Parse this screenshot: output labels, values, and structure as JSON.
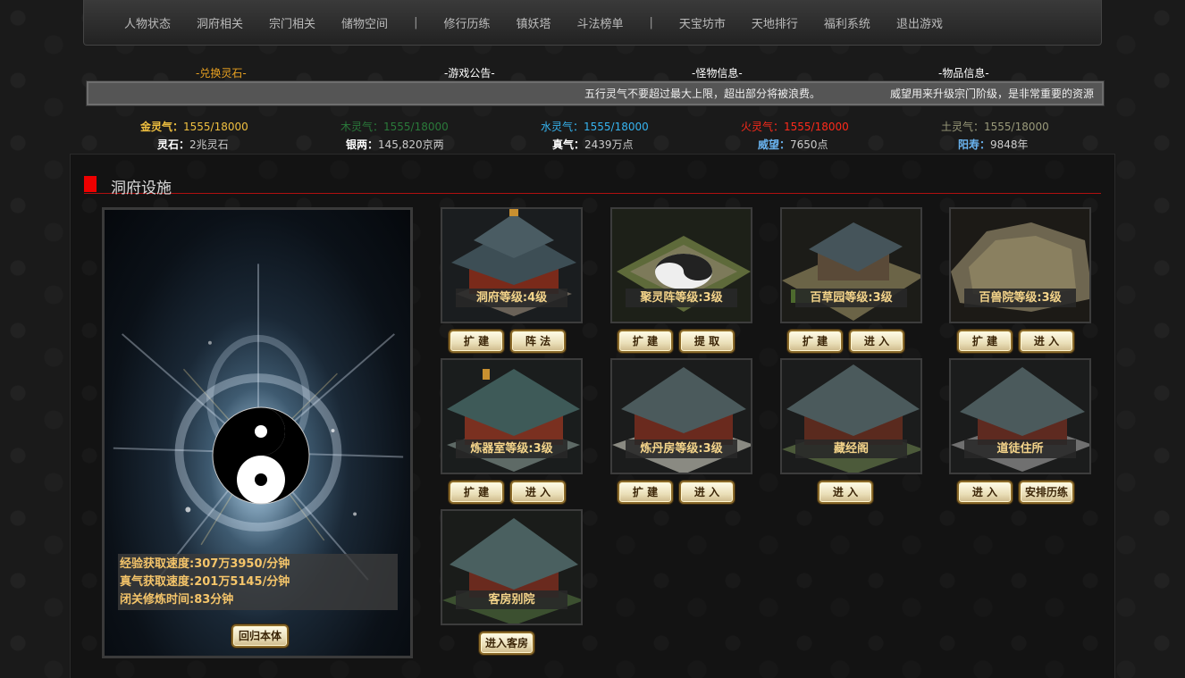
{
  "nav": {
    "items": [
      "人物状态",
      "洞府相关",
      "宗门相关",
      "储物空间",
      "|",
      "修行历练",
      "镇妖塔",
      "斗法榜单",
      "|",
      "天宝坊市",
      "天地排行",
      "福利系统",
      "退出游戏"
    ]
  },
  "notices": {
    "exchange": "-兑换灵石-",
    "announcement": "-游戏公告-",
    "monster": "-怪物信息-",
    "item": "-物品信息-",
    "marquee_1": "五行灵气不要超过最大上限，超出部分将被浪费。",
    "marquee_2": "威望用来升级宗门阶级，是非常重要的资源"
  },
  "resources": {
    "metal_label": "金灵气：",
    "metal_value": "1555/18000",
    "wood_label": "木灵气：",
    "wood_value": "1555/18000",
    "water_label": "水灵气：",
    "water_value": "1555/18000",
    "fire_label": "火灵气：",
    "fire_value": "1555/18000",
    "earth_label": "土灵气：",
    "earth_value": "1555/18000",
    "stone_label": "灵石：",
    "stone_value": "2兆灵石",
    "silver_label": "银两：",
    "silver_value": "145,820京两",
    "qi_label": "真气：",
    "qi_value": "2439万点",
    "prestige_label": "威望：",
    "prestige_value": "7650点",
    "life_label": "阳寿：",
    "life_value": "9848年"
  },
  "colors": {
    "metal": "#f0c040",
    "wood": "#2a7a3a",
    "water": "#36b4f0",
    "fire": "#ff2a1a",
    "earth": "#9a9a7a",
    "exchange": "#e8a020",
    "section_bar": "#ee0000",
    "stat_text": "#f5c56a"
  },
  "section": {
    "title": "洞府设施"
  },
  "cultivation": {
    "exp_speed": "经验获取速度:307万3950/分钟",
    "qi_speed": "真气获取速度:201万5145/分钟",
    "seclusion": "闭关修炼时间:83分钟",
    "return_button": "回归本体"
  },
  "facilities": [
    {
      "label": "洞府等级:4级",
      "buttons": [
        "扩 建",
        "阵 法"
      ]
    },
    {
      "label": "聚灵阵等级:3级",
      "buttons": [
        "扩 建",
        "提 取"
      ]
    },
    {
      "label": "百草园等级:3级",
      "buttons": [
        "扩 建",
        "进 入"
      ]
    },
    {
      "label": "百兽院等级:3级",
      "buttons": [
        "扩 建",
        "进 入"
      ]
    },
    {
      "label": "炼器室等级:3级",
      "buttons": [
        "扩 建",
        "进 入"
      ]
    },
    {
      "label": "炼丹房等级:3级",
      "buttons": [
        "扩 建",
        "进 入"
      ]
    },
    {
      "label": "藏经阁",
      "buttons": [
        "进 入"
      ]
    },
    {
      "label": "道徒住所",
      "buttons": [
        "进 入",
        "安排历练"
      ]
    },
    {
      "label": "客房别院",
      "buttons": [
        "进入客房"
      ]
    }
  ]
}
